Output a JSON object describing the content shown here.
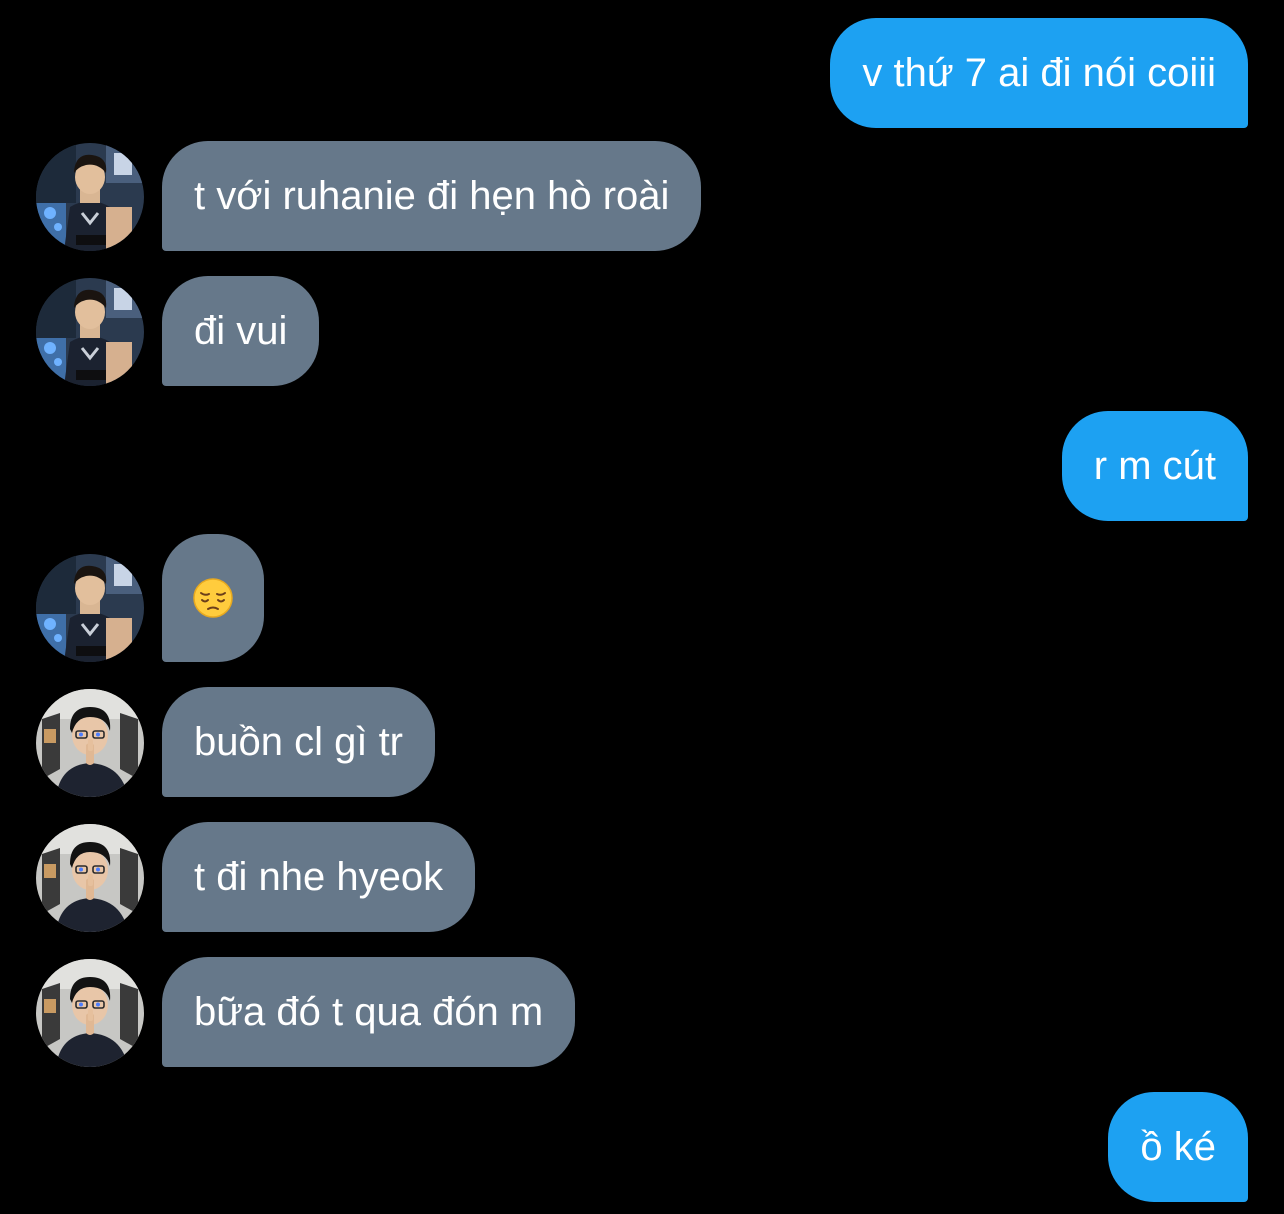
{
  "colors": {
    "background": "#000000",
    "sent_bubble": "#1da1f2",
    "received_bubble": "#66788a",
    "text": "#ffffff"
  },
  "messages": [
    {
      "side": "sent",
      "text": "v thứ 7 ai đi nói coiii"
    },
    {
      "side": "received",
      "avatar": "user-a-avatar",
      "text": "t với ruhanie đi hẹn hò roài"
    },
    {
      "side": "received",
      "avatar": "user-a-avatar",
      "text": "đi vui"
    },
    {
      "side": "sent",
      "text": "r m cút"
    },
    {
      "side": "received",
      "avatar": "user-a-avatar",
      "text": "😔"
    },
    {
      "side": "received",
      "avatar": "user-b-avatar",
      "text": "buồn cl gì tr"
    },
    {
      "side": "received",
      "avatar": "user-b-avatar",
      "text": "t đi nhe hyeok"
    },
    {
      "side": "received",
      "avatar": "user-b-avatar",
      "text": "bữa đó t qua đón m"
    },
    {
      "side": "sent",
      "text": "ồ ké"
    }
  ]
}
